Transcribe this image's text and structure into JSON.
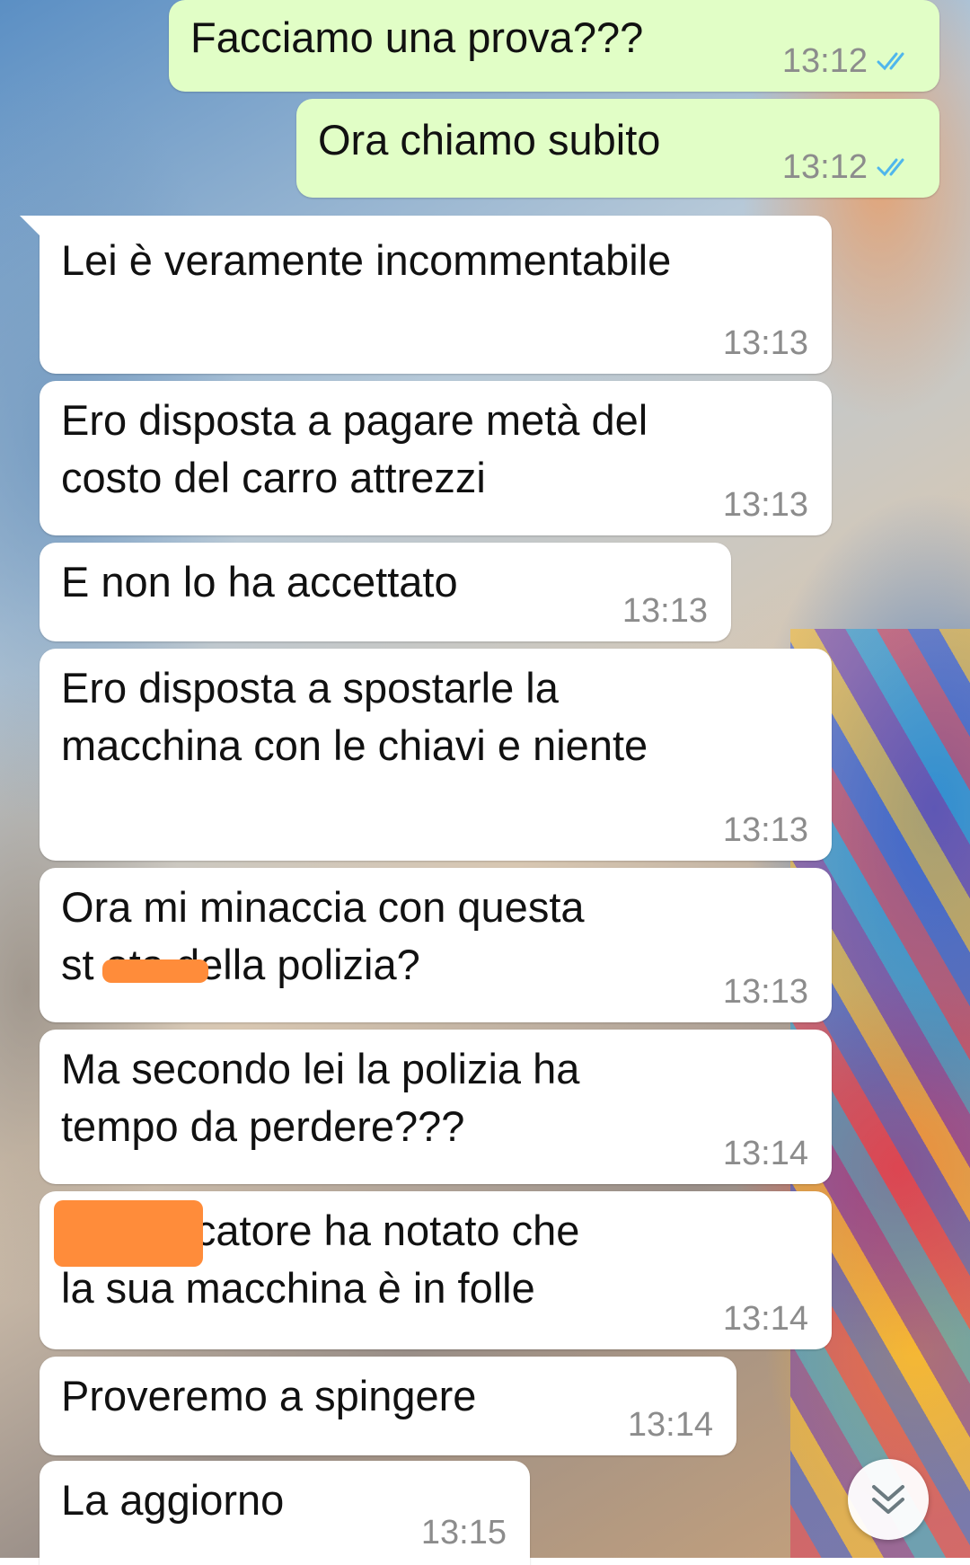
{
  "colors": {
    "outgoing_bubble": "#e1fec6",
    "incoming_bubble": "#ffffff",
    "read_ticks": "#4fb6ec",
    "timestamp": "#8c8c8c",
    "redaction": "#ff8c3a"
  },
  "messages": [
    {
      "direction": "outgoing",
      "text": "Facciamo una prova???",
      "time": "13:12",
      "status": "read"
    },
    {
      "direction": "outgoing",
      "text": "Ora chiamo subito",
      "time": "13:12",
      "status": "read"
    },
    {
      "direction": "incoming",
      "text": "Lei è veramente incommentabile",
      "time": "13:13"
    },
    {
      "direction": "incoming",
      "text": "Ero disposta a pagare metà del\ncosto del carro attrezzi",
      "time": "13:13"
    },
    {
      "direction": "incoming",
      "text": "E non lo ha accettato",
      "time": "13:13"
    },
    {
      "direction": "incoming",
      "text": "Ero disposta a spostarle la\nmacchina con le chiavi e niente",
      "time": "13:13"
    },
    {
      "direction": "incoming",
      "text": "Ora mi minaccia con questa\nst    ata della polizia?",
      "time": "13:13",
      "redacted": true
    },
    {
      "direction": "incoming",
      "text": "Ma secondo lei la polizia ha\ntempo da perdere???",
      "time": "13:14"
    },
    {
      "direction": "incoming",
      "text": "      il traslocatore ha notato che\nla sua macchina è in folle",
      "time": "13:14",
      "redacted": true
    },
    {
      "direction": "incoming",
      "text": "Proveremo a spingere",
      "time": "13:14"
    },
    {
      "direction": "incoming",
      "text": "La aggiorno",
      "time": "13:15"
    }
  ],
  "scroll_button": {
    "icon": "double-chevron-down-icon"
  }
}
